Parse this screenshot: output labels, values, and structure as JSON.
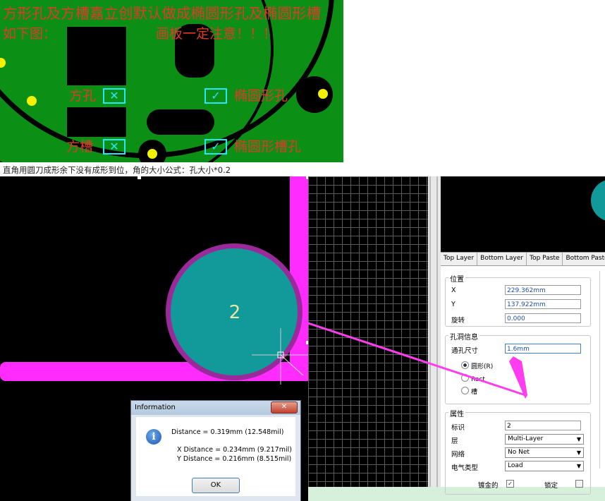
{
  "pcb_note": {
    "line1": "方形孔及方槽嘉立创默认做成椭圆形孔及椭圆形槽",
    "line2_left": "如下图：",
    "line2_right": "画板一定注意！！！",
    "square_hole": "方孔",
    "oval_hole": "椭圆形孔",
    "square_slot": "方槽",
    "oval_slot": "椭圆形槽孔",
    "mark_x": "✕",
    "mark_check": "✓"
  },
  "caption": "直角用圆刀成形余下没有成形到位，角的大小公式：孔大小*0.2",
  "canvas": {
    "pad_label": "2"
  },
  "dialog": {
    "title": "Information",
    "close": "✕",
    "distance": "Distance = 0.319mm (12.548mil)",
    "x_distance": "X Distance = 0.234mm (9.217mil)",
    "y_distance": "Y Distance = 0.216mm (8.515mil)",
    "ok": "OK"
  },
  "panel": {
    "layer_tabs": [
      "Top Layer",
      "Bottom Layer",
      "Top Paste",
      "Bottom Paste"
    ],
    "position_group": "位置",
    "x_label": "X",
    "x_value": "229.362mm",
    "y_label": "Y",
    "y_value": "137.922mm",
    "rotation_label": "旋转",
    "rotation_value": "0.000",
    "hole_group": "孔洞信息",
    "hole_size_label": "通孔尺寸",
    "hole_size_value": "1.6mm",
    "shape_round": "圆形(R)",
    "shape_rect": "Rect",
    "shape_slot": "槽",
    "props_group": "属性",
    "id_label": "标识",
    "id_value": "2",
    "layer_label": "层",
    "layer_value": "Multi-Layer",
    "net_label": "网络",
    "net_value": "No Net",
    "elec_label": "电气类型",
    "elec_value": "Load",
    "plated_label": "镀金的",
    "locked_label": "锁定"
  },
  "colors": {
    "pcb_green": "#0b8f15",
    "pcb_text": "#e23a2a",
    "mark_cyan": "#27e4ff",
    "outline_magenta": "#ff2bff",
    "pad_teal": "#129a9a",
    "pad_ring": "#9a2a9a",
    "annotation_arrow": "#ff3cf0"
  }
}
